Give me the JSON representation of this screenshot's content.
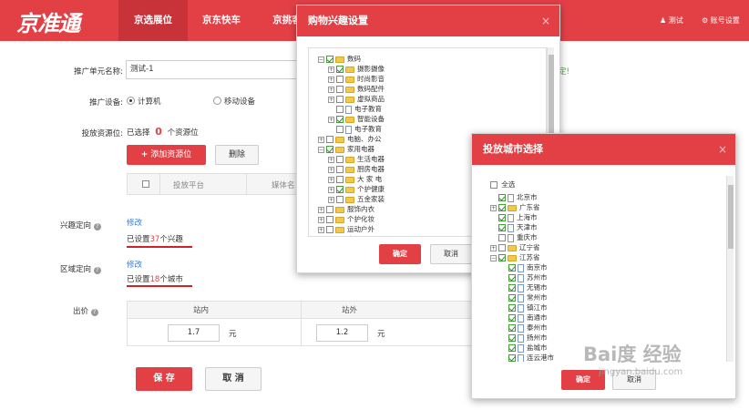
{
  "app": {
    "logo": "京准通",
    "logo_sub": "JZT.JD.COM",
    "nav": [
      "京选展位",
      "京东快车",
      "京挑客"
    ],
    "user": "测试",
    "settings": "账号设置"
  },
  "form": {
    "unit_name_label": "推广单元名称:",
    "unit_name_value": "测试-1",
    "device_label": "推广设备:",
    "device_pc": "计算机",
    "device_mobile": "移动设备",
    "resource_label": "投放资源位:",
    "resource_selected_prefix": "已选择",
    "resource_count": "0",
    "resource_suffix": "个资源位",
    "add_resource_button": "添加资源位",
    "delete_button": "删除",
    "table_headers": [
      "投放平台",
      "媒体名"
    ],
    "interest_label": "兴趣定向",
    "interest_edit": "修改",
    "interest_text_pre": "已设置",
    "interest_count": "37",
    "interest_text_post": "个兴趣",
    "region_label": "区域定向",
    "region_edit": "修改",
    "region_text_pre": "已设置",
    "region_count": "18",
    "region_text_post": "个城市",
    "bid_label": "出价",
    "bid_headers": [
      "站内",
      "站外"
    ],
    "bid_values": [
      "1.7",
      "1.2"
    ],
    "bid_unit": "元",
    "save_button": "保 存",
    "cancel_button": "取 消",
    "cut_right": "定!"
  },
  "interest_modal": {
    "title": "购物兴趣设置",
    "confirm": "确定",
    "cancel": "取消",
    "tree": [
      {
        "label": "数码",
        "level": 0,
        "expand": "−",
        "checked": true,
        "icon": "folder"
      },
      {
        "label": "摄影摄像",
        "level": 1,
        "expand": "+",
        "checked": true,
        "icon": "folder"
      },
      {
        "label": "时尚影音",
        "level": 1,
        "expand": "+",
        "checked": false,
        "icon": "folder"
      },
      {
        "label": "数码配件",
        "level": 1,
        "expand": "+",
        "checked": false,
        "icon": "folder"
      },
      {
        "label": "虚拟商品",
        "level": 1,
        "expand": "+",
        "checked": false,
        "icon": "folder"
      },
      {
        "label": "电子教育",
        "level": 1,
        "expand": "",
        "checked": false,
        "icon": "file"
      },
      {
        "label": "智能设备",
        "level": 1,
        "expand": "+",
        "checked": true,
        "icon": "folder"
      },
      {
        "label": "电子教育",
        "level": 1,
        "expand": "",
        "checked": false,
        "icon": "file"
      },
      {
        "label": "电脑、办公",
        "level": 0,
        "expand": "+",
        "checked": false,
        "icon": "folder"
      },
      {
        "label": "家用电器",
        "level": 0,
        "expand": "−",
        "checked": true,
        "icon": "folder"
      },
      {
        "label": "生活电器",
        "level": 1,
        "expand": "+",
        "checked": false,
        "icon": "folder"
      },
      {
        "label": "厨房电器",
        "level": 1,
        "expand": "+",
        "checked": false,
        "icon": "folder"
      },
      {
        "label": "大 家 电",
        "level": 1,
        "expand": "+",
        "checked": false,
        "icon": "folder"
      },
      {
        "label": "个护健康",
        "level": 1,
        "expand": "+",
        "checked": true,
        "icon": "folder"
      },
      {
        "label": "五金家装",
        "level": 1,
        "expand": "+",
        "checked": false,
        "icon": "folder"
      },
      {
        "label": "服饰内衣",
        "level": 0,
        "expand": "+",
        "checked": false,
        "icon": "folder"
      },
      {
        "label": "个护化妆",
        "level": 0,
        "expand": "+",
        "checked": false,
        "icon": "folder"
      },
      {
        "label": "运动户外",
        "level": 0,
        "expand": "+",
        "checked": false,
        "icon": "folder"
      },
      {
        "label": "家居",
        "level": 0,
        "expand": "+",
        "checked": false,
        "icon": "folder"
      }
    ]
  },
  "city_modal": {
    "title": "投放城市选择",
    "select_all": "全选",
    "confirm": "确定",
    "cancel": "取消",
    "tree": [
      {
        "label": "北京市",
        "level": 0,
        "expand": "",
        "checked": true,
        "icon": "file"
      },
      {
        "label": "广东省",
        "level": 0,
        "expand": "+",
        "checked": true,
        "icon": "folder"
      },
      {
        "label": "上海市",
        "level": 0,
        "expand": "",
        "checked": true,
        "icon": "file"
      },
      {
        "label": "天津市",
        "level": 0,
        "expand": "",
        "checked": true,
        "icon": "file"
      },
      {
        "label": "重庆市",
        "level": 0,
        "expand": "",
        "checked": false,
        "icon": "file"
      },
      {
        "label": "辽宁省",
        "level": 0,
        "expand": "+",
        "checked": false,
        "icon": "folder"
      },
      {
        "label": "江苏省",
        "level": 0,
        "expand": "−",
        "checked": true,
        "icon": "folder"
      },
      {
        "label": "南京市",
        "level": 1,
        "expand": "",
        "checked": true,
        "icon": "file"
      },
      {
        "label": "苏州市",
        "level": 1,
        "expand": "",
        "checked": true,
        "icon": "file"
      },
      {
        "label": "无锡市",
        "level": 1,
        "expand": "",
        "checked": true,
        "icon": "file"
      },
      {
        "label": "常州市",
        "level": 1,
        "expand": "",
        "checked": true,
        "icon": "file"
      },
      {
        "label": "镇江市",
        "level": 1,
        "expand": "",
        "checked": true,
        "icon": "file"
      },
      {
        "label": "南通市",
        "level": 1,
        "expand": "",
        "checked": true,
        "icon": "file"
      },
      {
        "label": "泰州市",
        "level": 1,
        "expand": "",
        "checked": true,
        "icon": "file"
      },
      {
        "label": "扬州市",
        "level": 1,
        "expand": "",
        "checked": true,
        "icon": "file"
      },
      {
        "label": "盐城市",
        "level": 1,
        "expand": "",
        "checked": true,
        "icon": "file"
      },
      {
        "label": "连云港市",
        "level": 1,
        "expand": "",
        "checked": true,
        "icon": "file"
      }
    ]
  },
  "watermark": {
    "brand": "Bai度 经验",
    "url": "jingyan.baidu.com"
  }
}
